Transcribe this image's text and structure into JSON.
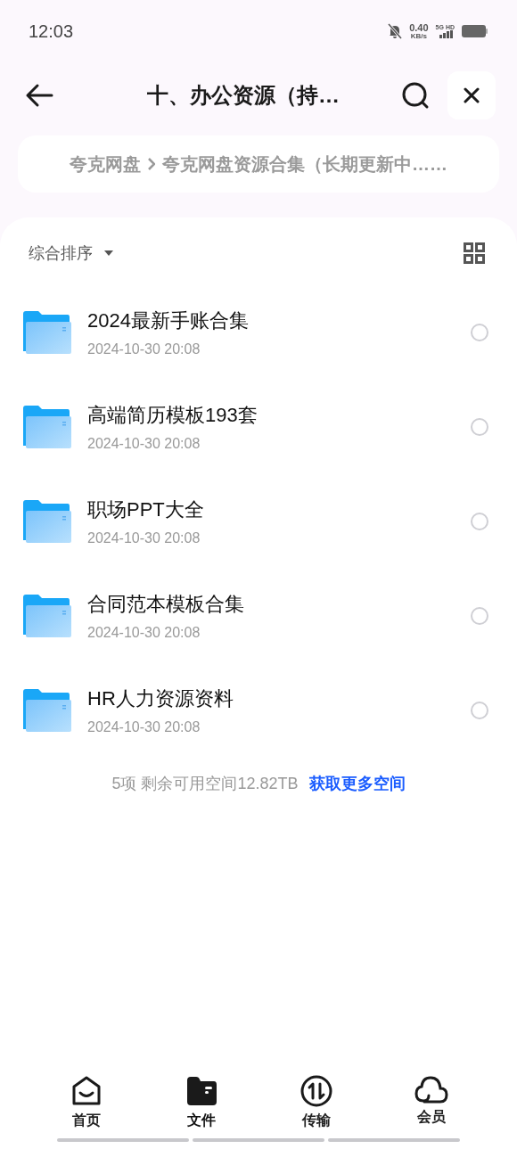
{
  "status_bar": {
    "time": "12:03",
    "speed": "0.40",
    "speed_unit": "KB/s",
    "network": "5G HD"
  },
  "header": {
    "title": "十、办公资源（持…"
  },
  "breadcrumb": [
    {
      "label": "夸克网盘"
    },
    {
      "label": "夸克网盘资源合集（长期更新中……"
    }
  ],
  "sort": {
    "label": "综合排序"
  },
  "files": [
    {
      "name": "2024最新手账合集",
      "date": "2024-10-30 20:08",
      "selected": false
    },
    {
      "name": "高端简历模板193套",
      "date": "2024-10-30 20:08",
      "selected": false
    },
    {
      "name": "职场PPT大全",
      "date": "2024-10-30 20:08",
      "selected": false
    },
    {
      "name": "合同范本模板合集",
      "date": "2024-10-30 20:08",
      "selected": false
    },
    {
      "name": "HR人力资源资料",
      "date": "2024-10-30 20:08",
      "selected": false
    }
  ],
  "summary": {
    "text": "5项 剩余可用空间12.82TB",
    "link": "获取更多空间"
  },
  "nav": [
    {
      "label": "首页",
      "kind": "home",
      "selected": false
    },
    {
      "label": "文件",
      "kind": "files",
      "selected": true
    },
    {
      "label": "传输",
      "kind": "transfer",
      "selected": false
    },
    {
      "label": "会员",
      "kind": "vip",
      "selected": false
    }
  ]
}
